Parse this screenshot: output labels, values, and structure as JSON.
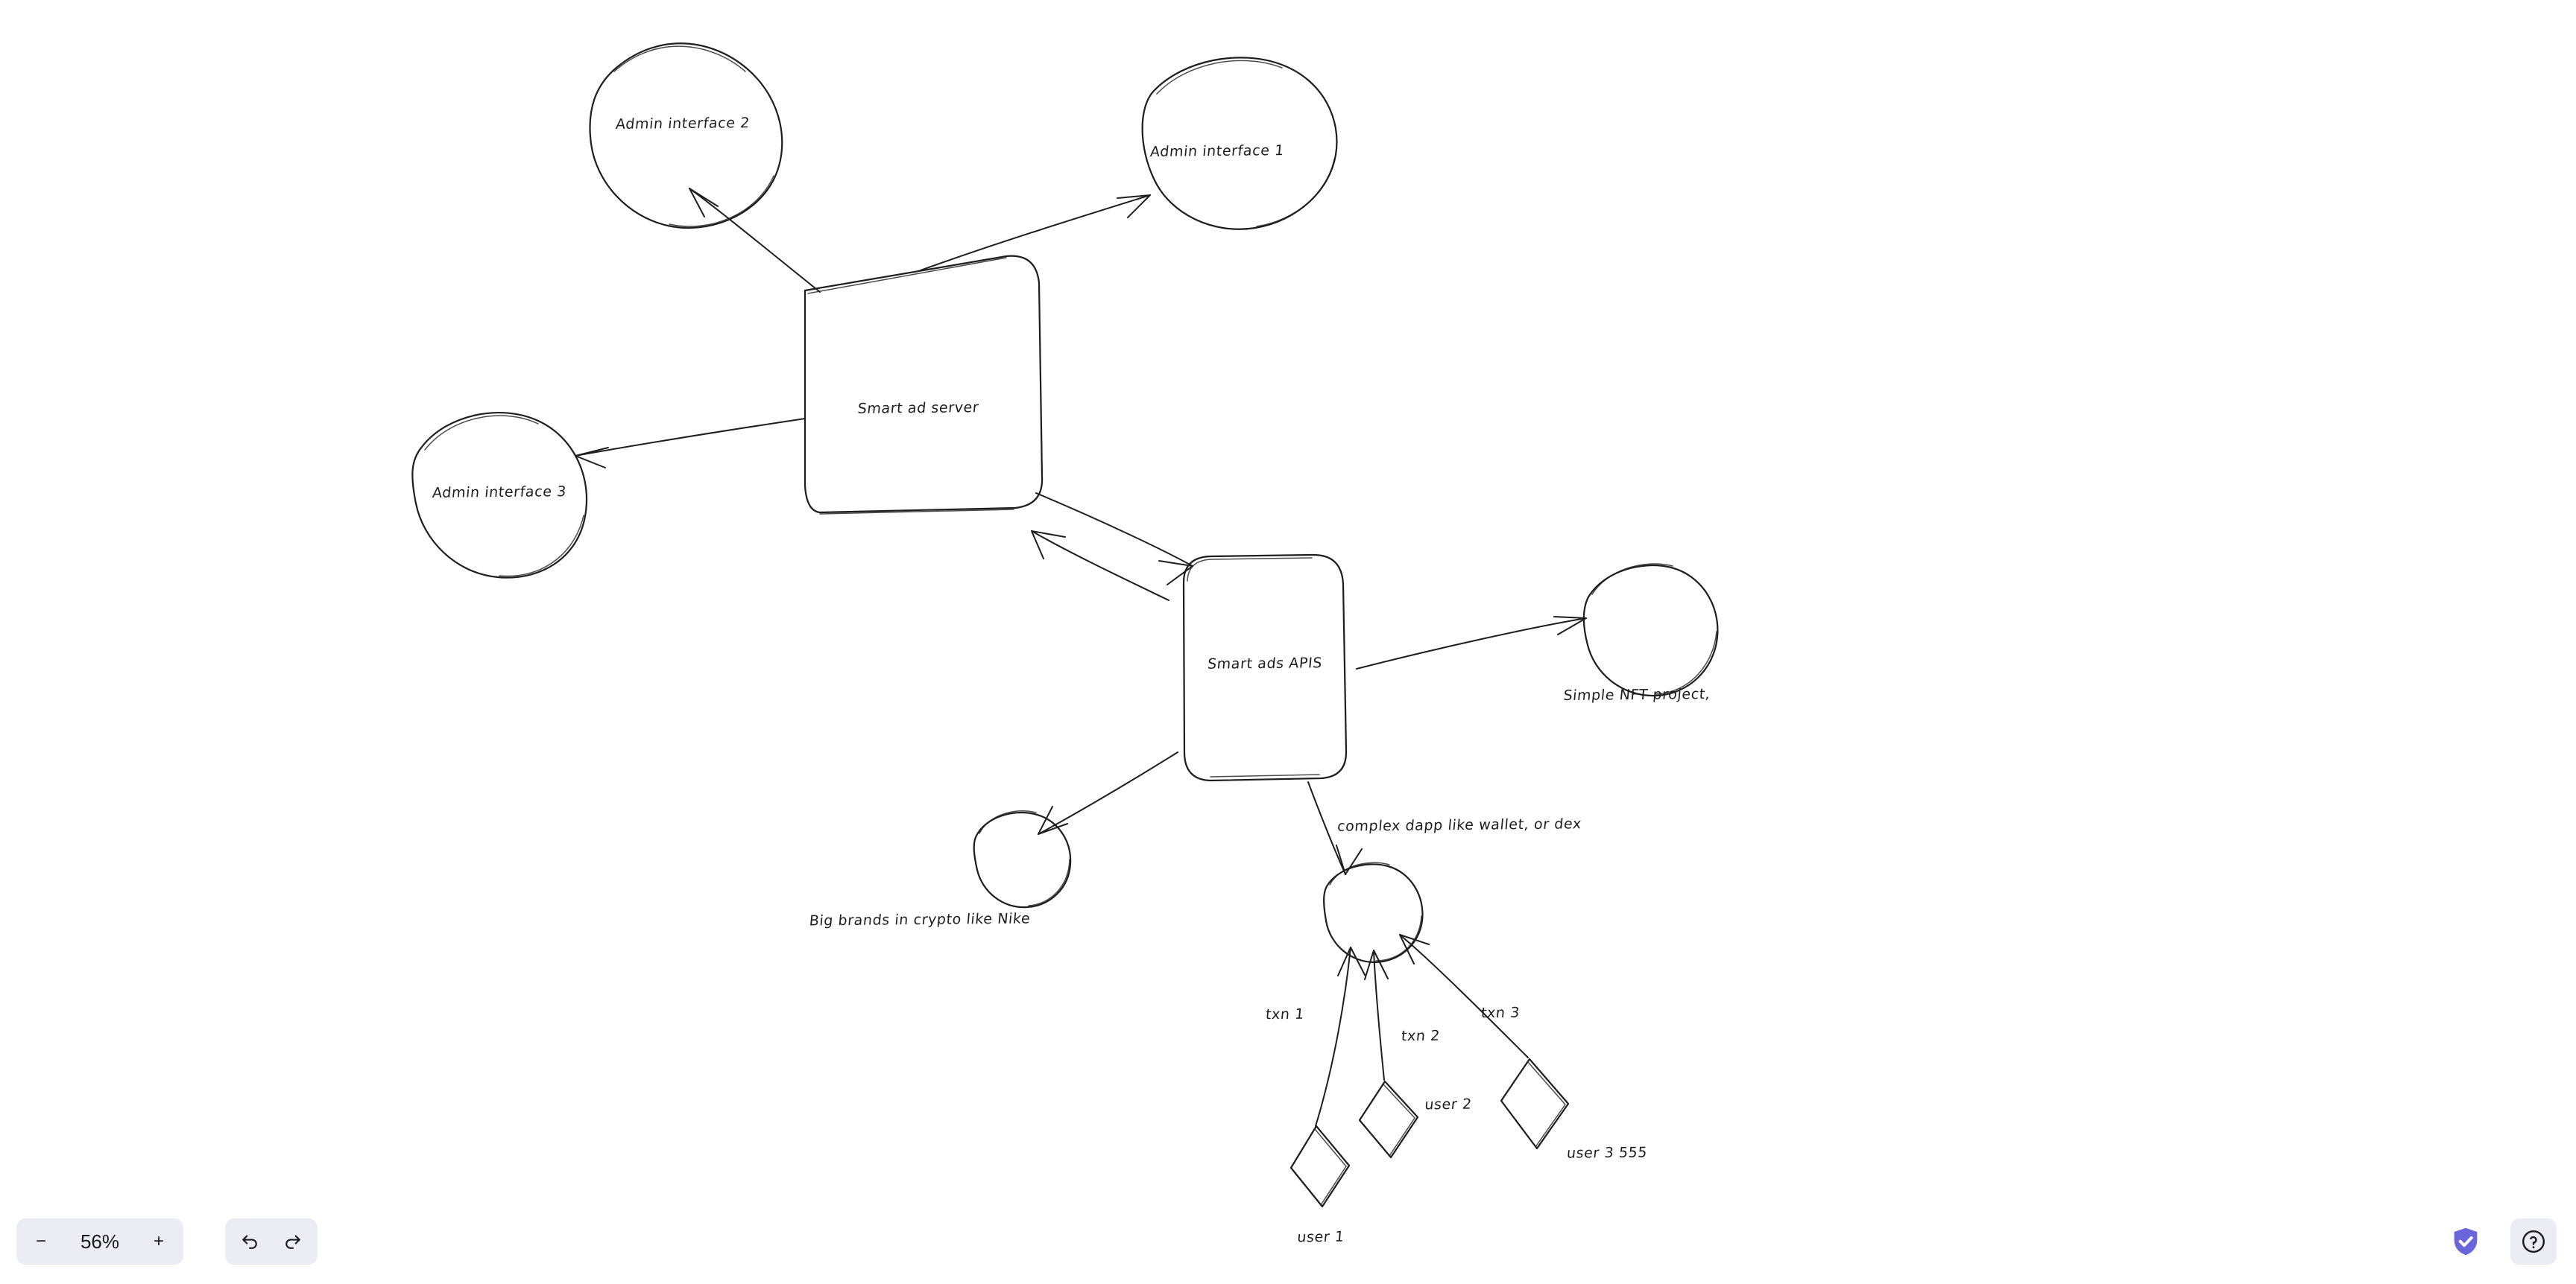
{
  "app": {
    "canvas_background": "#ffffff",
    "stroke_color": "#1e1e1e",
    "accent_color": "#6965db",
    "toolbar_background": "#ececf4"
  },
  "diagram": {
    "nodes": [
      {
        "id": "admin2",
        "label": "Admin interface 2",
        "shape": "ellipse"
      },
      {
        "id": "admin1",
        "label": "Admin interface 1",
        "shape": "ellipse"
      },
      {
        "id": "adserver",
        "label": "Smart ad server",
        "shape": "rounded-rect"
      },
      {
        "id": "admin3",
        "label": "Admin interface 3",
        "shape": "ellipse"
      },
      {
        "id": "apis",
        "label": "Smart ads APIS",
        "shape": "rounded-rect"
      },
      {
        "id": "nft",
        "label": "Simple NFT project,",
        "shape": "ellipse"
      },
      {
        "id": "brands",
        "label": "Big brands in crypto like Nike",
        "shape": "ellipse"
      },
      {
        "id": "dapp",
        "label": "complex dapp like wallet, or dex",
        "shape": "ellipse"
      },
      {
        "id": "user1",
        "label": "user 1",
        "shape": "diamond"
      },
      {
        "id": "user2",
        "label": "user 2",
        "shape": "diamond"
      },
      {
        "id": "user3",
        "label": "user 3 555",
        "shape": "diamond"
      }
    ],
    "edges": [
      {
        "from": "adserver",
        "to": "admin2",
        "label": ""
      },
      {
        "from": "adserver",
        "to": "admin1",
        "label": ""
      },
      {
        "from": "adserver",
        "to": "admin3",
        "label": ""
      },
      {
        "from": "adserver",
        "to": "apis",
        "label": ""
      },
      {
        "from": "apis",
        "to": "adserver",
        "label": ""
      },
      {
        "from": "apis",
        "to": "nft",
        "label": ""
      },
      {
        "from": "apis",
        "to": "brands",
        "label": ""
      },
      {
        "from": "apis",
        "to": "dapp",
        "label": ""
      },
      {
        "from": "user1",
        "to": "dapp",
        "label": "txn 1"
      },
      {
        "from": "user2",
        "to": "dapp",
        "label": "txn 2"
      },
      {
        "from": "user3",
        "to": "dapp",
        "label": "txn 3"
      }
    ],
    "labels": {
      "admin_interface_2": "Admin interface 2",
      "admin_interface_1": "Admin interface 1",
      "smart_ad_server": "Smart ad server",
      "admin_interface_3": "Admin interface 3",
      "smart_ads_apis": "Smart ads APIS",
      "simple_nft_project": "Simple NFT project,",
      "big_brands": "Big brands in crypto like Nike",
      "complex_dapp": "complex dapp like wallet, or dex",
      "txn_1": "txn 1",
      "txn_2": "txn 2",
      "txn_3": "txn 3",
      "user_1": "user 1",
      "user_2": "user 2",
      "user_3": "user 3 555"
    }
  },
  "toolbar": {
    "zoom_out_label": "−",
    "zoom_value": "56%",
    "zoom_in_label": "+",
    "undo_icon": "undo-icon",
    "redo_icon": "redo-icon"
  },
  "status": {
    "shield_icon": "shield-check-icon",
    "help_label": "?"
  }
}
